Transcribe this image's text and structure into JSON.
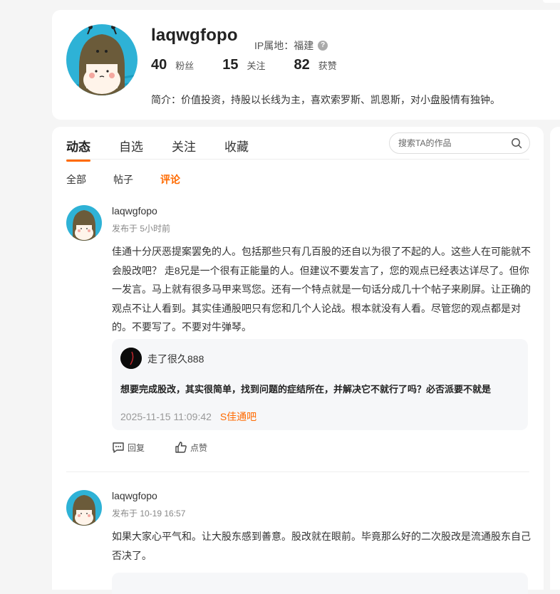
{
  "profile": {
    "username": "laqwgfopo",
    "ip_label": "IP属地：福建",
    "stats": [
      {
        "num": "40",
        "label": "粉丝"
      },
      {
        "num": "15",
        "label": "关注"
      },
      {
        "num": "82",
        "label": "获赞"
      }
    ],
    "bio": "简介：价值投资，持股以长线为主，喜欢索罗斯、凯恩斯，对小盘股情有独钟。"
  },
  "tabs": [
    "动态",
    "自选",
    "关注",
    "收藏"
  ],
  "search": {
    "placeholder": "搜索TA的作品"
  },
  "subtabs": [
    "全部",
    "帖子",
    "评论"
  ],
  "posts": [
    {
      "user": "laqwgfopo",
      "time": "发布于 5小时前",
      "body": "佳通十分厌恶提案罢免的人。包括那些只有几百股的还自以为很了不起的人。这些人在可能就不会股改吧？ 走8兄是一个很有正能量的人。但建议不要发言了，您的观点已经表达详尽了。但你一发言。马上就有很多马甲来骂您。还有一个特点就是一句话分成几十个帖子来刷屏。让正确的观点不让人看到。其实佳通股吧只有您和几个人论战。根本就没有人看。尽管您的观点都是对的。不要写了。不要对牛弹琴。",
      "quote": {
        "user": "走了很久888",
        "text": "想要完成股改，其实很简单，找到问题的症结所在，并解决它不就行了吗？必否派要不就是",
        "date": "2025-11-15 11:09:42",
        "bar": "S佳通吧"
      },
      "actions": {
        "reply": "回复",
        "like": "点赞"
      }
    },
    {
      "user": "laqwgfopo",
      "time": "发布于 10-19 16:57",
      "body": "如果大家心平气和。让大股东感到善意。股改就在眼前。毕竟那么好的二次股改是流通股东自己否决了。"
    }
  ]
}
